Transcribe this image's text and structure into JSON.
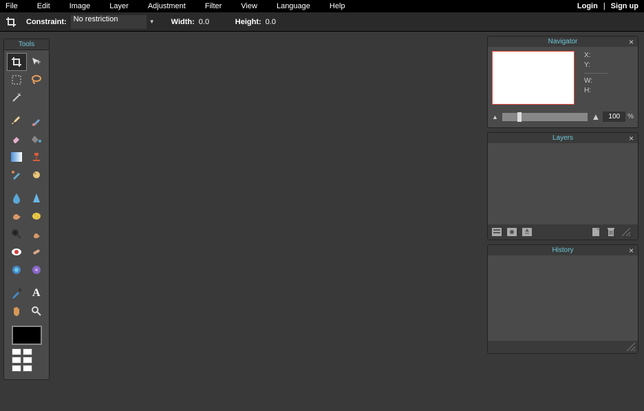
{
  "menu": [
    "File",
    "Edit",
    "Image",
    "Layer",
    "Adjustment",
    "Filter",
    "View",
    "Language",
    "Help"
  ],
  "auth": {
    "login": "Login",
    "signup": "Sign up"
  },
  "options": {
    "constraint_label": "Constraint:",
    "constraint_value": "No restriction",
    "width_label": "Width:",
    "width_value": "0.0",
    "height_label": "Height:",
    "height_value": "0.0"
  },
  "tools": {
    "title": "Tools"
  },
  "navigator": {
    "title": "Navigator",
    "x": "X:",
    "y": "Y:",
    "w": "W:",
    "h": "H:",
    "zoom": "100",
    "pct": "%"
  },
  "layers": {
    "title": "Layers"
  },
  "history": {
    "title": "History"
  }
}
